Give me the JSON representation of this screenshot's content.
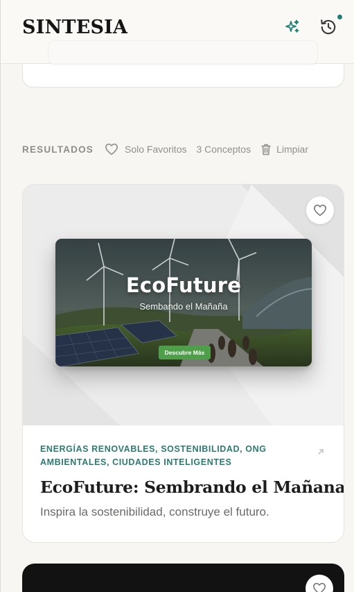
{
  "app": {
    "logo": "SINTESIA"
  },
  "header": {
    "icons": [
      "sparkle-icon",
      "history-icon"
    ],
    "notification_color": "#1f7f75"
  },
  "results": {
    "title": "RESULTADOS",
    "favorites_toggle": "Solo Favoritos",
    "count": "3 Conceptos",
    "clear": "Limpiar"
  },
  "cards": [
    {
      "preview": {
        "title": "EcoFuture",
        "subtitle": "Sembando el Mañaña",
        "cta": "Descubre Más"
      },
      "tags": "ENERGÍAS RENOVABLES, SOSTENIBILIDAD, ONG AMBIENTALES, CIUDADES INTELIGENTES",
      "title": "EcoFuture: Sembrando el Mañana",
      "description": "Inspira la sostenibilidad, construye el futuro.",
      "favorited": false
    }
  ],
  "colors": {
    "accent": "#2d7a71",
    "background": "#f7f6f3",
    "cta_green": "#4f9e4a"
  }
}
